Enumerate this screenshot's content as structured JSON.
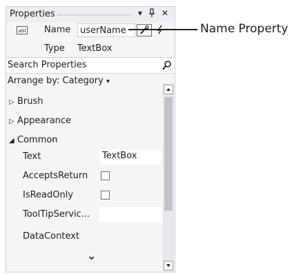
{
  "panel": {
    "title": "Properties",
    "pin_glyph": "▾",
    "autohide_glyph": "ᵽ",
    "close_glyph": "✕"
  },
  "element": {
    "type_icon_text": "abl",
    "name_label": "Name",
    "name_value": "userName",
    "type_label": "Type",
    "type_value": "TextBox"
  },
  "search": {
    "placeholder": "Search Properties"
  },
  "arrange": {
    "label": "Arrange by: Category",
    "dropdown_glyph": "▾"
  },
  "categories": [
    {
      "label": "Brush",
      "expanded": false
    },
    {
      "label": "Appearance",
      "expanded": false
    },
    {
      "label": "Common",
      "expanded": true
    }
  ],
  "properties": [
    {
      "label": "Text",
      "value": "TextBox",
      "kind": "text"
    },
    {
      "label": "AcceptsReturn",
      "value": "",
      "kind": "checkbox"
    },
    {
      "label": "IsReadOnly",
      "value": "",
      "kind": "checkbox"
    },
    {
      "label": "ToolTipServic...",
      "value": "",
      "kind": "text"
    },
    {
      "label": "DataContext",
      "value": "",
      "kind": "none"
    }
  ],
  "more_chevron": "⌄",
  "callout": {
    "text": "Name Property"
  },
  "colors": {
    "panel_bg": "#f5f5f5",
    "title_bg": "#eeeef2",
    "border": "#cccedb"
  }
}
